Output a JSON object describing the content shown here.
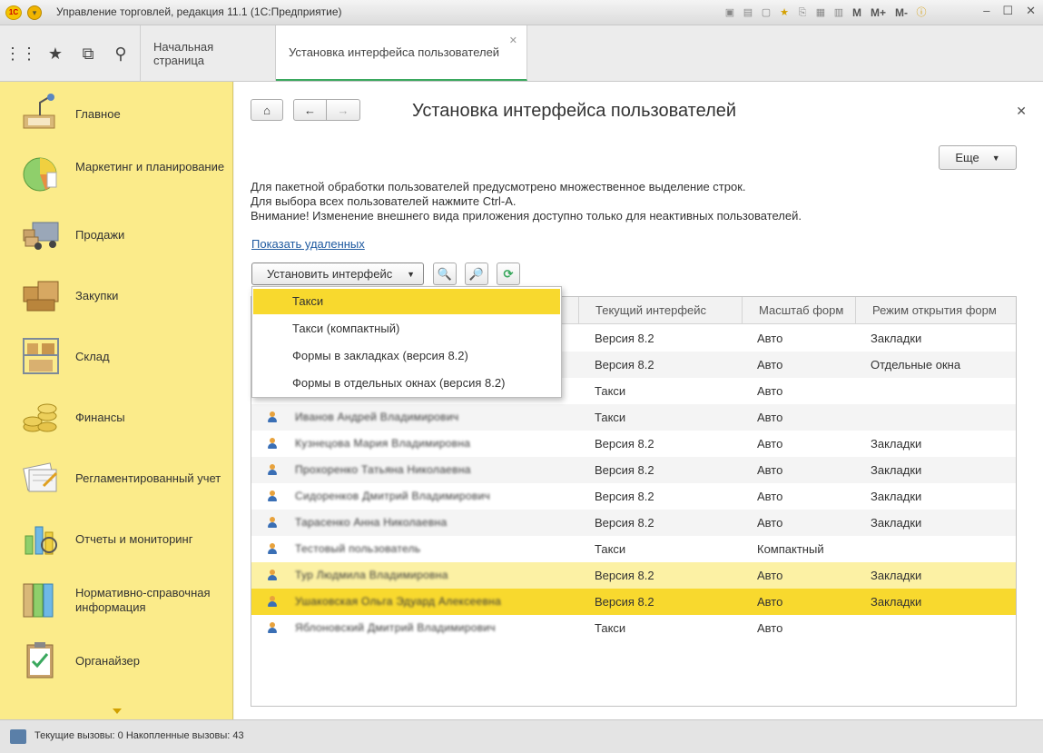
{
  "window": {
    "title": "Управление торговлей, редакция 11.1  (1С:Предприятие)",
    "tools": [
      "M",
      "M+",
      "M-"
    ]
  },
  "topnav": {
    "tabs": [
      {
        "label": "Начальная страница"
      },
      {
        "label": "Установка интерфейса пользователей"
      }
    ]
  },
  "sidebar": {
    "items": [
      {
        "label": "Главное",
        "icon": "desk-lamp-icon"
      },
      {
        "label": "Маркетинг и планирование",
        "icon": "pie-chart-icon"
      },
      {
        "label": "Продажи",
        "icon": "truck-icon"
      },
      {
        "label": "Закупки",
        "icon": "boxes-icon"
      },
      {
        "label": "Склад",
        "icon": "shelf-icon"
      },
      {
        "label": "Финансы",
        "icon": "coins-icon"
      },
      {
        "label": "Регламентированный учет",
        "icon": "documents-icon"
      },
      {
        "label": "Отчеты и мониторинг",
        "icon": "bar-chart-icon"
      },
      {
        "label": "Нормативно-справочная информация",
        "icon": "folders-icon"
      },
      {
        "label": "Органайзер",
        "icon": "clipboard-icon"
      }
    ]
  },
  "form": {
    "title": "Установка интерфейса пользователей",
    "more_label": "Еще",
    "info": [
      "Для пакетной обработки пользователей предусмотрено множественное выделение строк.",
      "Для выбора всех пользователей нажмите Ctrl-A.",
      "Внимание! Изменение внешнего вида приложения доступно только для неактивных пользователей."
    ],
    "show_deleted_link": "Показать удаленных",
    "set_interface_label": "Установить интерфейс"
  },
  "dropdown": {
    "items": [
      {
        "label": "Такси",
        "active": true
      },
      {
        "label": "Такси (компактный)"
      },
      {
        "label": "Формы в закладках (версия 8.2)"
      },
      {
        "label": "Формы в отдельных окнах (версия 8.2)"
      }
    ]
  },
  "table": {
    "columns": [
      "Текущий интерфейс",
      "Масштаб форм",
      "Режим открытия форм"
    ],
    "rows": [
      {
        "name": "",
        "interface": "Версия 8.2",
        "scale": "Авто",
        "mode": "Закладки"
      },
      {
        "name": "",
        "interface": "Версия 8.2",
        "scale": "Авто",
        "mode": "Отдельные окна"
      },
      {
        "name": "",
        "interface": "Такси",
        "scale": "Авто",
        "mode": ""
      },
      {
        "name": "Иванов Андрей Владимирович",
        "interface": "Такси",
        "scale": "Авто",
        "mode": ""
      },
      {
        "name": "Кузнецова Мария Владимировна",
        "interface": "Версия 8.2",
        "scale": "Авто",
        "mode": "Закладки"
      },
      {
        "name": "Прохоренко Татьяна Николаевна",
        "interface": "Версия 8.2",
        "scale": "Авто",
        "mode": "Закладки"
      },
      {
        "name": "Сидоренков Дмитрий Владимирович",
        "interface": "Версия 8.2",
        "scale": "Авто",
        "mode": "Закладки"
      },
      {
        "name": "Тарасенко Анна Николаевна",
        "interface": "Версия 8.2",
        "scale": "Авто",
        "mode": "Закладки"
      },
      {
        "name": "Тестовый пользователь",
        "interface": "Такси",
        "scale": "Компактный",
        "mode": ""
      },
      {
        "name": "Тур Людмила Владимировна",
        "interface": "Версия 8.2",
        "scale": "Авто",
        "mode": "Закладки"
      },
      {
        "name": "Ушаковская Ольга Эдуард Алексеевна",
        "interface": "Версия 8.2",
        "scale": "Авто",
        "mode": "Закладки"
      },
      {
        "name": "Яблоновский Дмитрий Владимирович",
        "interface": "Такси",
        "scale": "Авто",
        "mode": ""
      }
    ]
  },
  "status": {
    "text": "Текущие вызовы: 0   Накопленные вызовы: 43"
  },
  "colors": {
    "sidebar_bg": "#fbeb8a",
    "accent_yellow": "#f8d92e",
    "selected_row": "#fcf1a4",
    "tab_underline": "#3aa85e",
    "link": "#1f5aa0"
  }
}
